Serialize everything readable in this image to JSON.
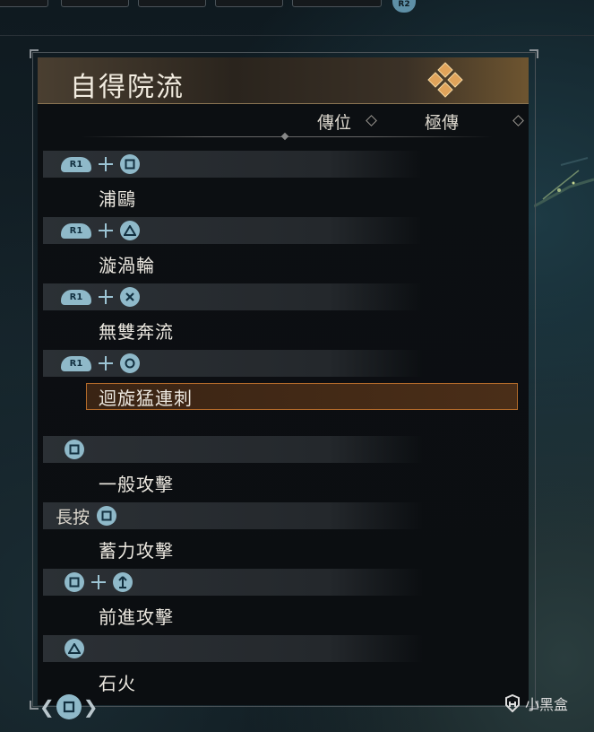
{
  "header": {
    "top_badge": "R2",
    "title": "自得院流"
  },
  "columns": {
    "col1": "傳位",
    "col2": "極傳"
  },
  "moves": [
    {
      "combo": {
        "hold": "",
        "buttons": [
          "R1",
          "square"
        ]
      },
      "name": "浦鷗",
      "selected": false
    },
    {
      "combo": {
        "hold": "",
        "buttons": [
          "R1",
          "triangle"
        ]
      },
      "name": "漩渦輪",
      "selected": false
    },
    {
      "combo": {
        "hold": "",
        "buttons": [
          "R1",
          "cross"
        ]
      },
      "name": "無雙奔流",
      "selected": false
    },
    {
      "combo": {
        "hold": "",
        "buttons": [
          "R1",
          "circle"
        ]
      },
      "name": "迴旋猛連刺",
      "selected": true
    },
    {
      "combo": {
        "hold": "",
        "buttons": [
          "square"
        ]
      },
      "name": "一般攻擊",
      "selected": false
    },
    {
      "combo": {
        "hold": "長按",
        "buttons": [
          "square"
        ]
      },
      "name": "蓄力攻擊",
      "selected": false
    },
    {
      "combo": {
        "hold": "",
        "buttons": [
          "square",
          "left-stick-up"
        ]
      },
      "name": "前進攻擊",
      "selected": false
    },
    {
      "combo": {
        "hold": "",
        "buttons": [
          "triangle"
        ]
      },
      "name": "石火",
      "selected": false
    }
  ],
  "button_labels": {
    "r1": "R1"
  },
  "watermark": {
    "text": "小黑盒"
  },
  "colors": {
    "button_fill": "#8fb9c9",
    "selection_border": "#b26a2a",
    "title_gold": "#6e5530"
  },
  "icons": {
    "title_emblem": "gold-diamond-crest-icon",
    "nav": "square-button-icon"
  }
}
